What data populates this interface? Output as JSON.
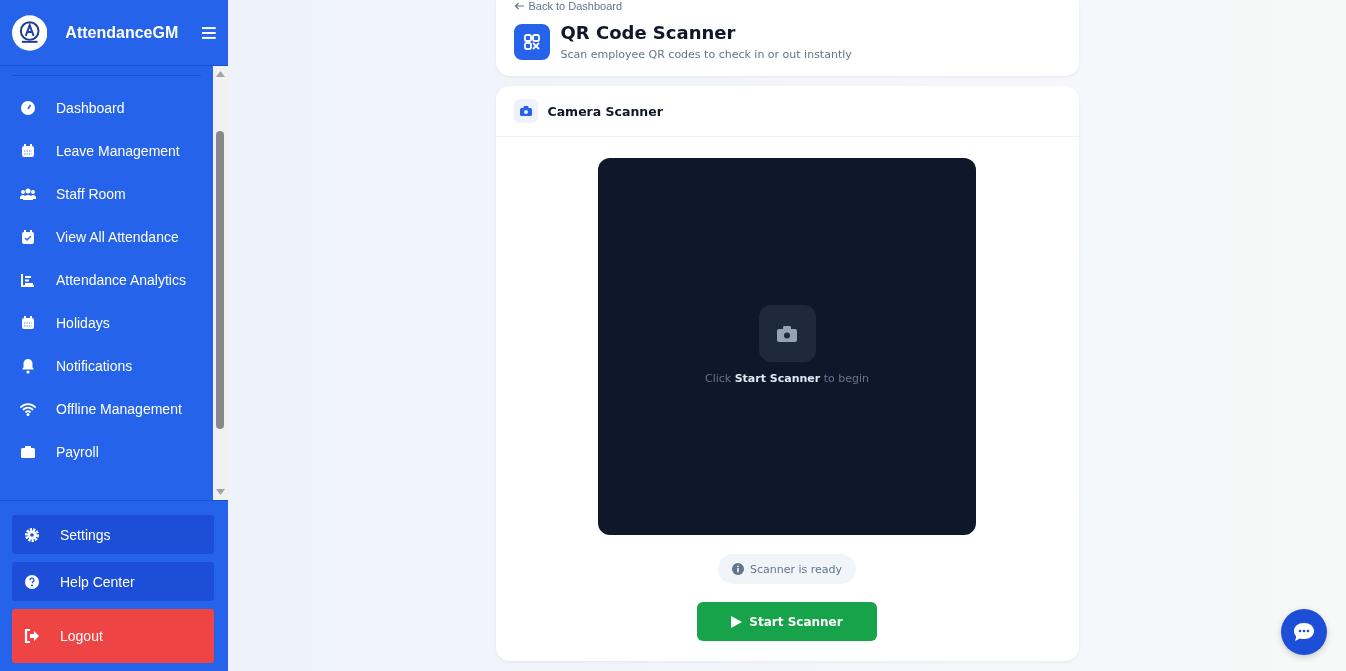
{
  "sidebar": {
    "brand": "AttendanceGM",
    "items": [
      {
        "label": "Dashboard"
      },
      {
        "label": "Leave Management"
      },
      {
        "label": "Staff Room"
      },
      {
        "label": "View All Attendance"
      },
      {
        "label": "Attendance Analytics"
      },
      {
        "label": "Holidays"
      },
      {
        "label": "Notifications"
      },
      {
        "label": "Offline Management"
      },
      {
        "label": "Payroll"
      }
    ],
    "footer": [
      {
        "label": "Settings",
        "kind": "normal"
      },
      {
        "label": "Help Center",
        "kind": "normal"
      },
      {
        "label": "Logout",
        "kind": "danger"
      }
    ]
  },
  "header": {
    "back_link": "Back to Dashboard",
    "title": "QR Code Scanner",
    "subtitle": "Scan employee QR codes to check in or out instantly"
  },
  "scanner": {
    "title": "Camera Scanner",
    "prompt": "Click **Start Scanner** to begin",
    "status": "Scanner is ready",
    "button": "Start Scanner"
  }
}
